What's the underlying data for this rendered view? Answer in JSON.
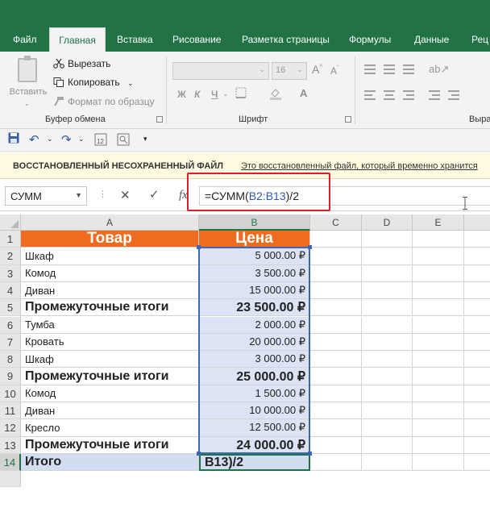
{
  "ribbon": {
    "tabs": [
      "Файл",
      "Главная",
      "Вставка",
      "Рисование",
      "Разметка страницы",
      "Формулы",
      "Данные",
      "Рец"
    ],
    "active_tab": "Главная",
    "clipboard": {
      "paste": "Вставить",
      "cut": "Вырезать",
      "copy": "Копировать",
      "format_painter": "Формат по образцу",
      "label": "Буфер обмена"
    },
    "font": {
      "font_size": "16",
      "bold": "Ж",
      "italic": "К",
      "underline": "Ч",
      "label": "Шрифт"
    },
    "alignment_label": "Выра"
  },
  "message_bar": {
    "title": "ВОССТАНОВЛЕННЫЙ НЕСОХРАНЕННЫЙ ФАЙЛ",
    "link": "Это восстановленный файл, который временно хранится"
  },
  "formula_bar": {
    "name_box": "СУММ",
    "cancel": "✕",
    "enter": "✓",
    "fx": "fx",
    "formula_prefix": "=СУММ(",
    "formula_ref": "B2:B13",
    "formula_suffix": ")/2"
  },
  "columns": [
    "A",
    "B",
    "C",
    "D",
    "E"
  ],
  "rows": [
    {
      "num": "1",
      "a": "Товар",
      "b": "Цена",
      "type": "header"
    },
    {
      "num": "2",
      "a": "Шкаф",
      "b": "5 000.00 ₽",
      "type": "item"
    },
    {
      "num": "3",
      "a": "Комод",
      "b": "3 500.00 ₽",
      "type": "item"
    },
    {
      "num": "4",
      "a": "Диван",
      "b": "15 000.00 ₽",
      "type": "item"
    },
    {
      "num": "5",
      "a": "Промежуточные итоги",
      "b": "23 500.00 ₽",
      "type": "subtotal"
    },
    {
      "num": "6",
      "a": "Тумба",
      "b": "2 000.00 ₽",
      "type": "item"
    },
    {
      "num": "7",
      "a": "Кровать",
      "b": "20 000.00 ₽",
      "type": "item"
    },
    {
      "num": "8",
      "a": "Шкаф",
      "b": "3 000.00 ₽",
      "type": "item"
    },
    {
      "num": "9",
      "a": "Промежуточные итоги",
      "b": "25 000.00 ₽",
      "type": "subtotal"
    },
    {
      "num": "10",
      "a": "Комод",
      "b": "1 500.00 ₽",
      "type": "item"
    },
    {
      "num": "11",
      "a": "Диван",
      "b": "10 000.00 ₽",
      "type": "item"
    },
    {
      "num": "12",
      "a": "Кресло",
      "b": "12 500.00 ₽",
      "type": "item"
    },
    {
      "num": "13",
      "a": "Промежуточные итоги",
      "b": "24 000.00 ₽",
      "type": "subtotal"
    },
    {
      "num": "14",
      "a": "Итого",
      "b": "B13)/2",
      "type": "total"
    }
  ],
  "colors": {
    "excel_green": "#217346",
    "header_orange": "#ed6c1f",
    "selection_blue": "#3a67b6",
    "highlight_red": "#e01b2b"
  }
}
